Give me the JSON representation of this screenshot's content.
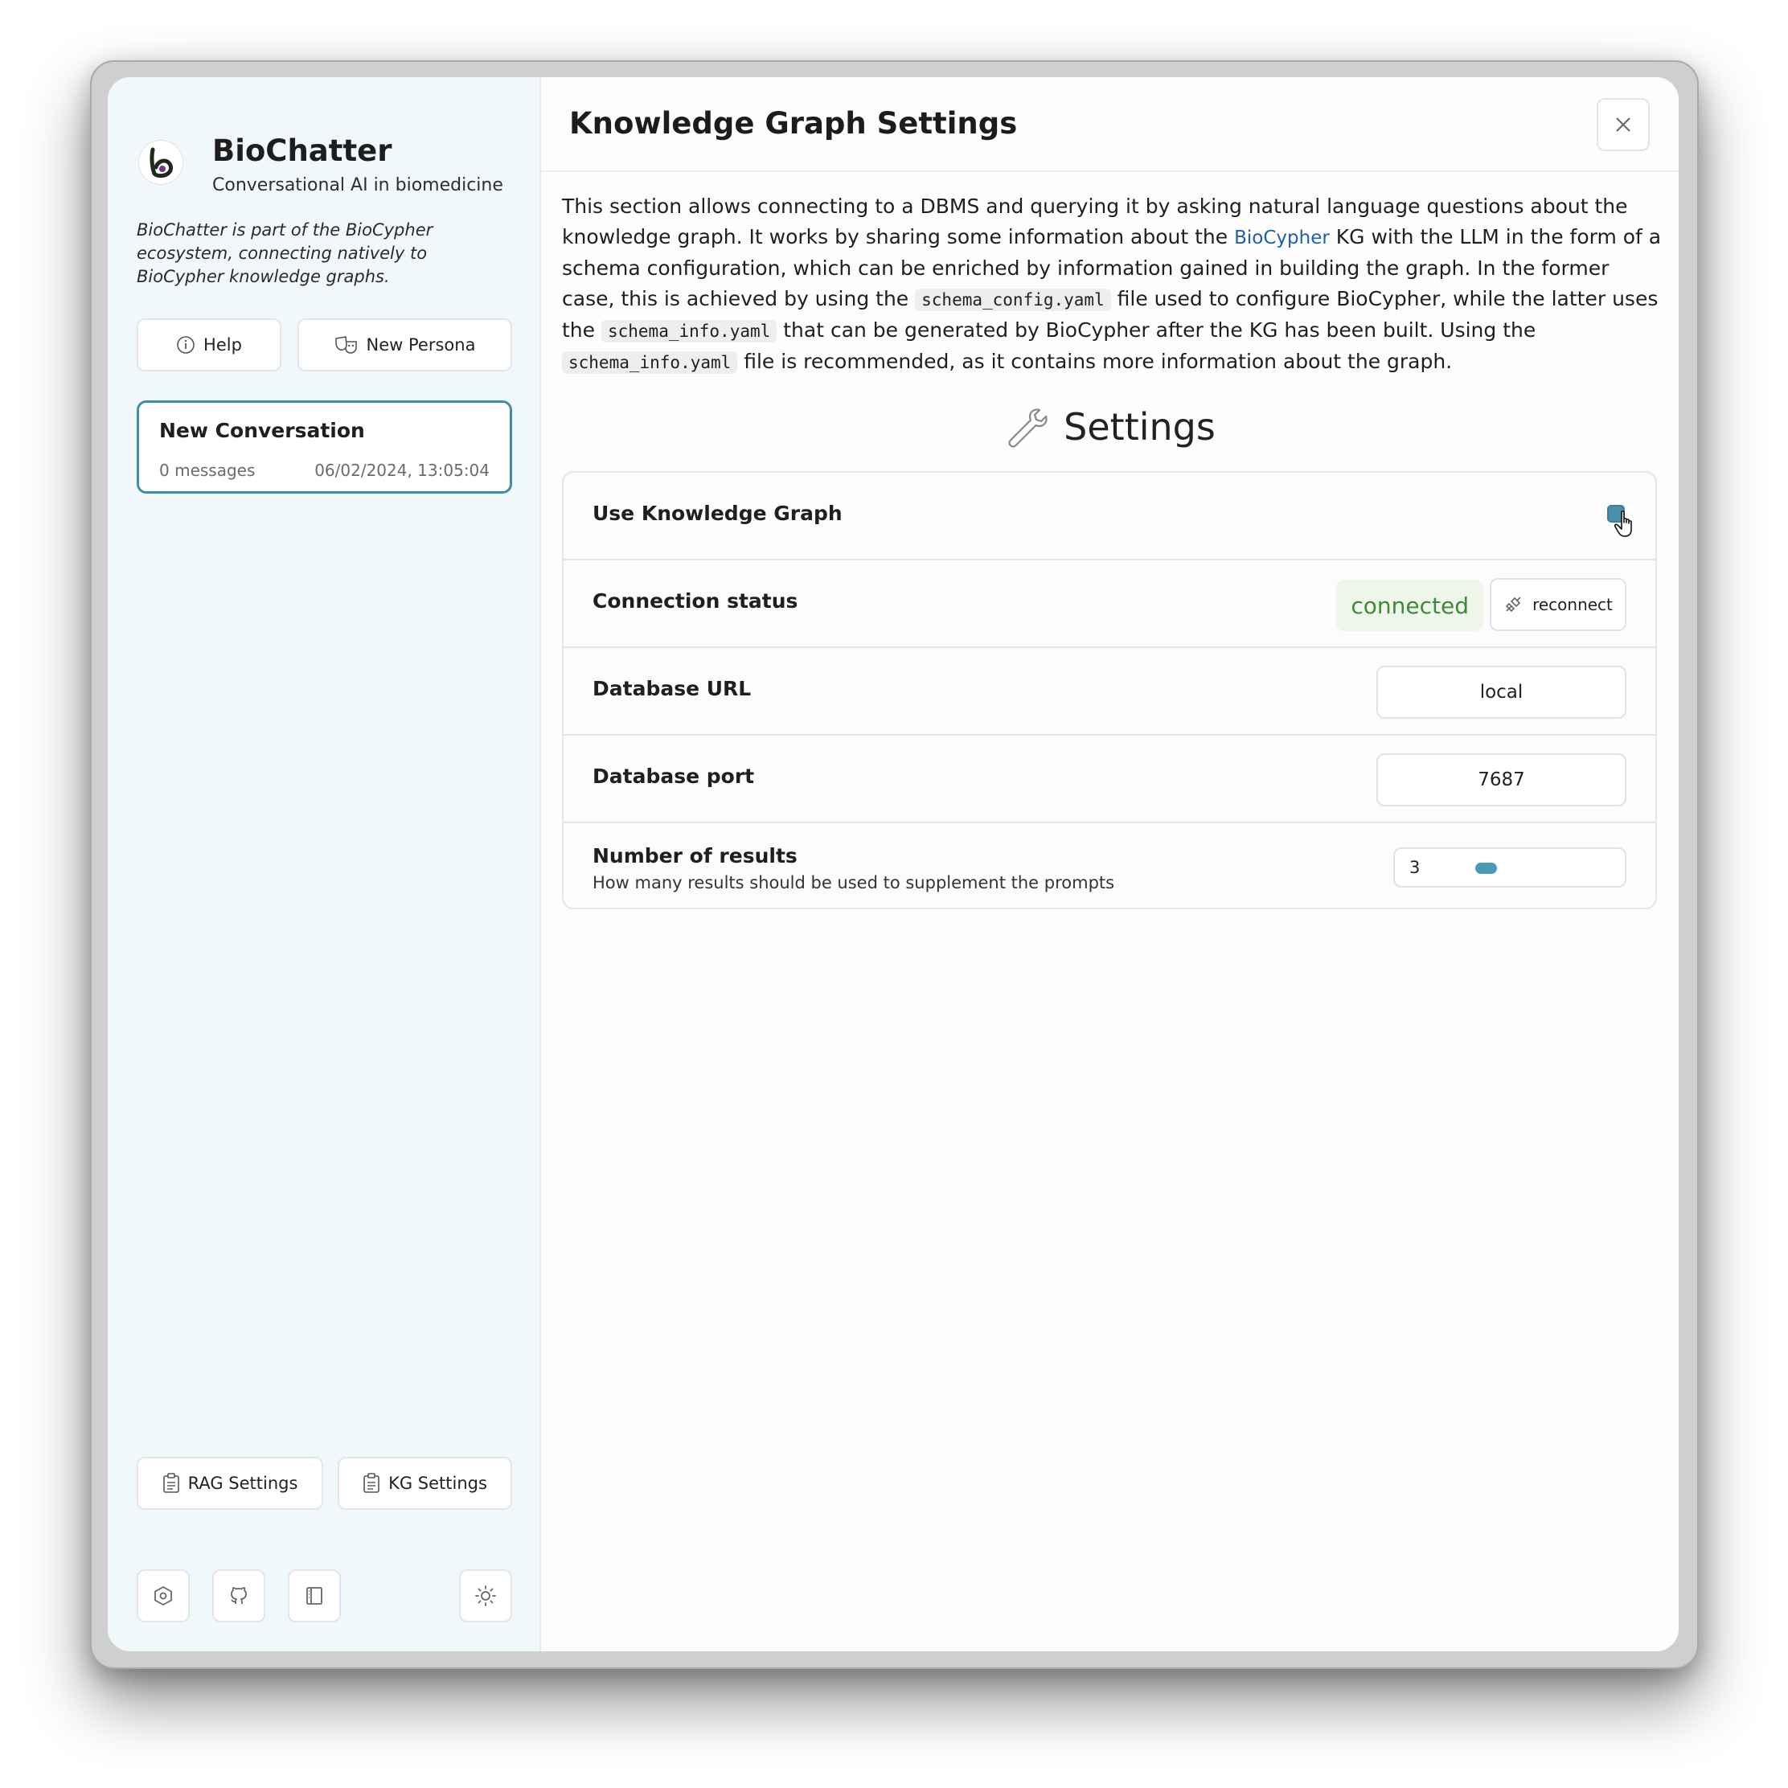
{
  "sidebar": {
    "app_title": "BioChatter",
    "app_subtitle": "Conversational AI in biomedicine",
    "description": "BioChatter is part of the BioCypher ecosystem, connecting natively to BioCypher knowledge graphs.",
    "help_label": "Help",
    "new_persona_label": "New Persona",
    "conversation": {
      "title": "New Conversation",
      "message_count": "0 messages",
      "timestamp": "06/02/2024, 13:05:04"
    },
    "rag_settings_label": "RAG Settings",
    "kg_settings_label": "KG Settings",
    "footer_icons": [
      "settings-hex-icon",
      "github-icon",
      "book-icon",
      "sun-icon"
    ]
  },
  "main": {
    "title": "Knowledge Graph Settings",
    "intro": {
      "part1": "This section allows connecting to a DBMS and querying it by asking natural language questions about the knowledge graph. It works by sharing some information about the ",
      "link": "BioCypher",
      "part2": " KG with the LLM in the form of a schema configuration, which can be enriched by information gained in building the graph. In the former case, this is achieved by using the ",
      "code1": "schema_config.yaml",
      "part3": " file used to configure BioCypher, while the latter uses the ",
      "code2": "schema_info.yaml",
      "part4": " that can be generated by BioCypher after the KG has been built. Using the ",
      "code3": "schema_info.yaml",
      "part5": " file is recommended, as it contains more information about the graph."
    },
    "settings_heading": "Settings",
    "rows": {
      "use_kg": {
        "label": "Use Knowledge Graph",
        "checked": true
      },
      "connection": {
        "label": "Connection status",
        "status": "connected",
        "reconnect_label": "reconnect"
      },
      "db_url": {
        "label": "Database URL",
        "value": "local"
      },
      "db_port": {
        "label": "Database port",
        "value": "7687"
      },
      "num_results": {
        "label": "Number of results",
        "description": "How many results should be used to supplement the prompts",
        "value": "3",
        "slider_fraction": 0.18
      }
    }
  },
  "colors": {
    "accent": "#3f8ea7",
    "status_green": "#3e8a3a",
    "link_blue": "#1f5fa8"
  }
}
